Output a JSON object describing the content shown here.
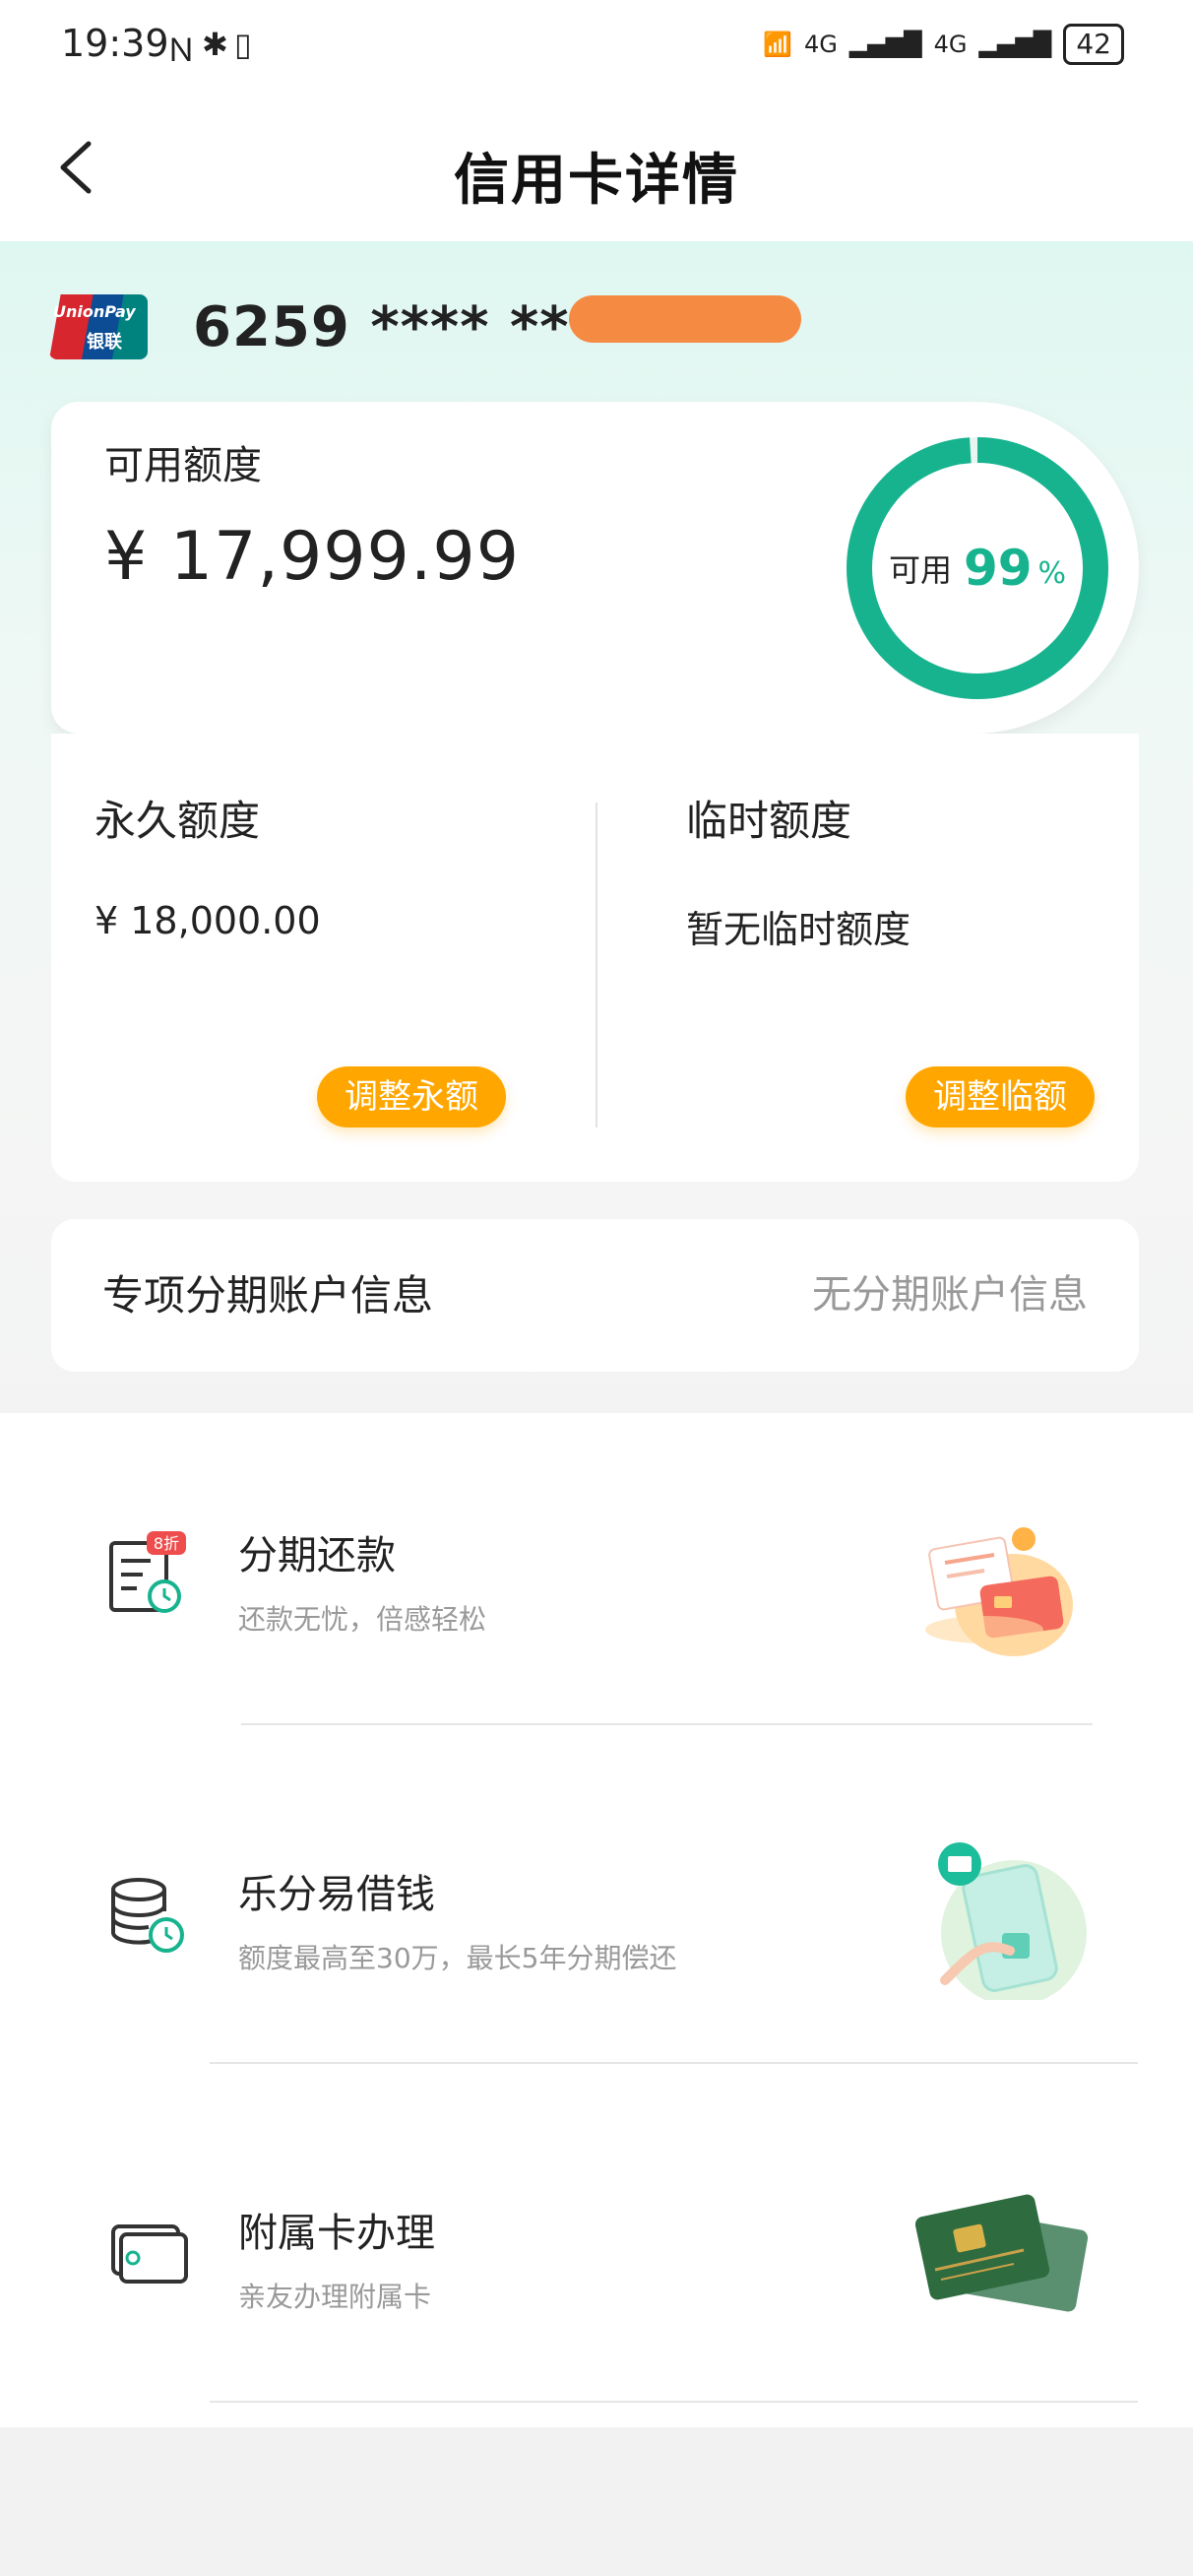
{
  "status_bar": {
    "time": "19:39",
    "icons_left": [
      "nfc-icon",
      "bluetooth-icon",
      "vibrate-icon"
    ],
    "net1": "4G",
    "net2": "4G",
    "battery": "42"
  },
  "header": {
    "title": "信用卡详情"
  },
  "card": {
    "number": "6259 **** ****",
    "brand_en": "UnionPay",
    "brand_cn": "银联",
    "mask_color": "#f58a42"
  },
  "available": {
    "label": "可用额度",
    "amount": "¥ 17,999.99",
    "ring_label": "可用",
    "percent_value": 99,
    "percent_text": "99",
    "percent_symbol": "%",
    "accent": "#17b38f"
  },
  "limits": {
    "permanent": {
      "title": "永久额度",
      "value": "¥ 18,000.00",
      "button": "调整永额"
    },
    "temporary": {
      "title": "临时额度",
      "value": "暂无临时额度",
      "button": "调整临额"
    },
    "button_color": "#ffa700"
  },
  "installment_info": {
    "label": "专项分期账户信息",
    "value": "无分期账户信息"
  },
  "services": [
    {
      "title": "分期还款",
      "subtitle": "还款无忧，倍感轻松",
      "badge": "8折",
      "icon": "installment-bill-icon"
    },
    {
      "title": "乐分易借钱",
      "subtitle": "额度最高至30万，最长5年分期偿还",
      "icon": "coin-stack-clock-icon"
    },
    {
      "title": "附属卡办理",
      "subtitle": "亲友办理附属卡",
      "icon": "card-icon"
    }
  ]
}
